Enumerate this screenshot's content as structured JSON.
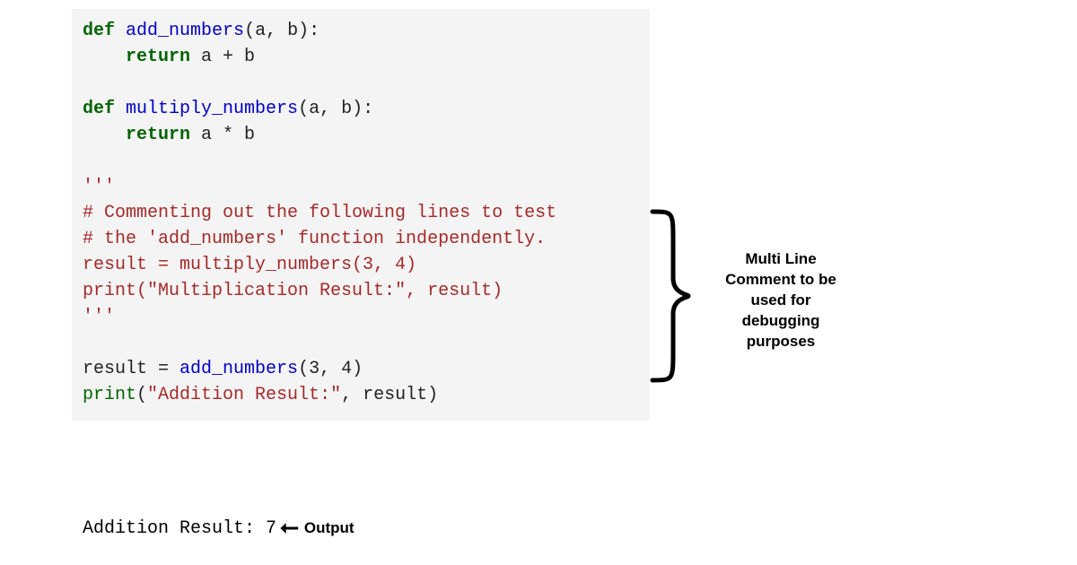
{
  "code": {
    "def": "def",
    "fn_add": "add_numbers",
    "sig_add": "(a, b):",
    "return": "return",
    "ret_add": " a + b",
    "fn_mul": "multiply_numbers",
    "sig_mul": "(a, b):",
    "ret_mul": " a * b",
    "triple_open": "'''",
    "cmt1": "# Commenting out the following lines to test",
    "cmt2": "# the 'add_numbers' function independently.",
    "assign_mul": "result = multiply_numbers(3, 4)",
    "print": "print",
    "print_mul_args": "(\"Multiplication Result:\", result)",
    "triple_close": "'''",
    "assign_add_lhs": "result = ",
    "assign_add_args": "(3, 4)",
    "print_add_args_open": "(",
    "print_add_str": "\"Addition Result:\"",
    "print_add_args_rest": ", result)"
  },
  "output": {
    "text": "Addition Result: 7",
    "label": "Output"
  },
  "annotation": {
    "line1": "Multi Line",
    "line2": "Comment to be",
    "line3": "used for",
    "line4": "debugging",
    "line5": "purposes"
  }
}
